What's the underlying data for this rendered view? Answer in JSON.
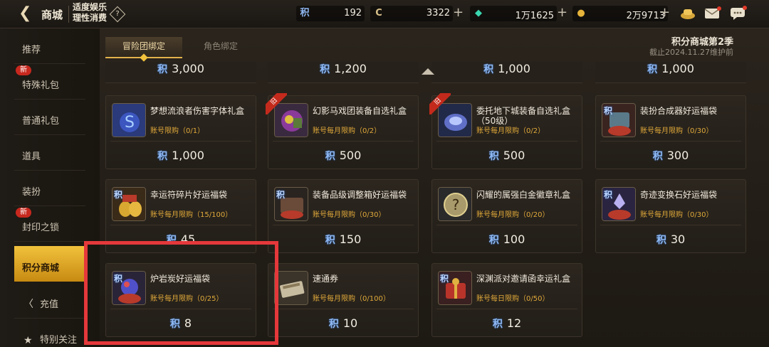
{
  "header": {
    "title": "商城",
    "warning_line1": "适度娱乐",
    "warning_line2": "理性消费",
    "help_symbol": "?"
  },
  "currencies": [
    {
      "icon_text": "积",
      "value": "192",
      "color": "#8fb8f2"
    },
    {
      "icon_text": "C",
      "value": "3322",
      "color": "#d9c28a"
    },
    {
      "icon_text": "◆",
      "value": "1万1625",
      "color": "#3ad6b0"
    },
    {
      "icon_text": "●",
      "value": "2万9713",
      "color": "#e6b43a"
    }
  ],
  "sidebar": {
    "items": [
      {
        "label": "推荐",
        "badge": ""
      },
      {
        "label": "特殊礼包",
        "badge": "新"
      },
      {
        "label": "普通礼包",
        "badge": ""
      },
      {
        "label": "道具",
        "badge": ""
      },
      {
        "label": "装扮",
        "badge": ""
      },
      {
        "label": "封印之锁",
        "badge": "新"
      },
      {
        "label": "积分商城",
        "badge": ""
      },
      {
        "label": "充值",
        "badge": ""
      },
      {
        "label": "特别关注",
        "badge": ""
      }
    ]
  },
  "tabs": {
    "active": "冒险团绑定",
    "inactive": "角色绑定"
  },
  "season": {
    "title": "积分商城第2季",
    "subtitle": "截止2024.11.27维护前"
  },
  "price_mark": "积",
  "top_row_prices": [
    "3,000",
    "1,200",
    "1,000",
    "1,000"
  ],
  "cards": [
    {
      "name": "梦想流浪者伤害字体礼盒",
      "limit": "账号限购（0/1）",
      "price": "1,000",
      "old": false,
      "ji": false
    },
    {
      "name": "幻影马戏团装备自选礼盒",
      "limit": "账号每月限购（0/2）",
      "price": "500",
      "old": true,
      "ji": false
    },
    {
      "name": "委托地下城装备自选礼盒（50级）",
      "limit": "账号每月限购（0/2）",
      "price": "500",
      "old": true,
      "ji": false
    },
    {
      "name": "装扮合成器好运福袋",
      "limit": "账号每月限购（0/30）",
      "price": "300",
      "old": false,
      "ji": true
    },
    {
      "name": "幸运符碎片好运福袋",
      "limit": "账号每月限购（15/100）",
      "price": "45",
      "old": false,
      "ji": true
    },
    {
      "name": "装备品级调整箱好运福袋",
      "limit": "账号每月限购（0/30）",
      "price": "150",
      "old": false,
      "ji": true
    },
    {
      "name": "闪耀的属强白金徽章礼盒",
      "limit": "账号每月限购（0/20）",
      "price": "100",
      "old": false,
      "ji": false
    },
    {
      "name": "奇迹变换石好运福袋",
      "limit": "账号每月限购（0/30）",
      "price": "30",
      "old": false,
      "ji": true
    },
    {
      "name": "炉岩炭好运福袋",
      "limit": "账号每月限购（0/25）",
      "price": "8",
      "old": false,
      "ji": true
    },
    {
      "name": "速通券",
      "limit": "账号每月限购（0/100）",
      "price": "10",
      "old": false,
      "ji": false
    },
    {
      "name": "深渊派对邀请函幸运礼盒",
      "limit": "账号每日限购（0/50）",
      "price": "12",
      "old": false,
      "ji": true
    }
  ],
  "old_badge_text": "旧",
  "accent_color": "#f2c23c",
  "highlight_color": "#e5383b"
}
